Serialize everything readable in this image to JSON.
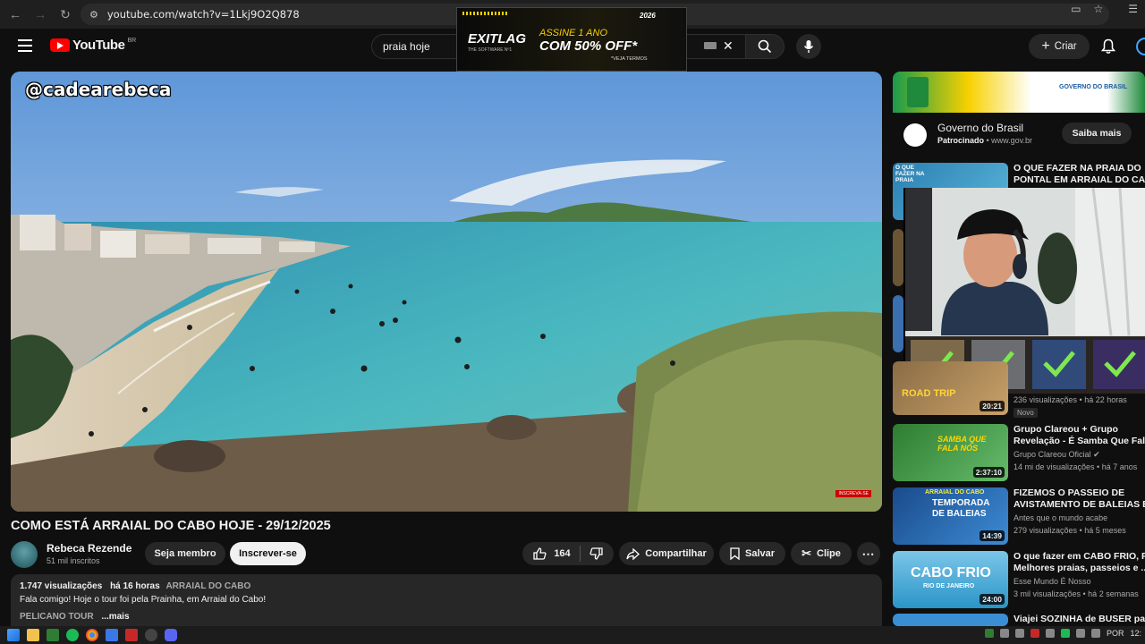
{
  "browser": {
    "url": "youtube.com/watch?v=1Lkj9O2Q878"
  },
  "header": {
    "logo_text": "YouTube",
    "country_code": "BR",
    "search_value": "praia hoje",
    "create_label": "Criar"
  },
  "ad": {
    "brand": "EXITLAG",
    "brand_tag": "THE SOFTWARE Nº1",
    "line1": "ASSINE 1 ANO",
    "line2": "COM 50% OFF*",
    "line3": "*VEJA TERMOS",
    "year": "2026"
  },
  "player": {
    "watermark": "@cadearebeca",
    "rec_badge": "INSCREVA-SE"
  },
  "video": {
    "title": "COMO ESTÁ ARRAIAL DO CABO HOJE - 29/12/2025",
    "channel": "Rebeca Rezende",
    "subscribers": "51 mil inscritos",
    "member_label": "Seja membro",
    "subscribe_label": "Inscrever-se",
    "likes": "164",
    "share_label": "Compartilhar",
    "save_label": "Salvar",
    "clip_label": "Clipe"
  },
  "description": {
    "views": "1.747 visualizações",
    "age": "há 16 horas",
    "tag": "ARRAIAL DO CABO",
    "line1": "Fala comigo! Hoje o tour foi pela Prainha, em Arraial do Cabo!",
    "line2_cut": "PELICANO TOUR",
    "more": "...mais"
  },
  "sponsor": {
    "name": "Governo do Brasil",
    "label": "Patrocinado",
    "domain": "www.gov.br",
    "cta": "Saiba mais",
    "banner_text": "GOVERNO DO BRASIL"
  },
  "recommendations": [
    {
      "title_l1": "O QUE FAZER NA PRAIA DO",
      "title_l2": "PONTAL EM ARRAIAL DO CAB",
      "thumb_text": "O QUE FAZER NA PRAIA",
      "channel": "",
      "stats": "",
      "duration": ""
    },
    {
      "title_l1": "",
      "title_l2": "",
      "thumb_text": "ROAD TRIP",
      "channel": "",
      "stats": "236 visualizações • há 22 horas",
      "badge": "Novo",
      "duration": "20:21"
    },
    {
      "title_l1": "Grupo Clareou + Grupo",
      "title_l2": "Revelação - É Samba Que Fala",
      "thumb_text": "SAMBA QUE FALA NÓS",
      "channel": "Grupo Clareou Oficial",
      "stats": "14 mi de visualizações • há 7 anos",
      "duration": "2:37:10"
    },
    {
      "title_l1": "FIZEMOS O PASSEIO DE",
      "title_l2": "AVISTAMENTO DE BALEIAS E...",
      "thumb_text_a": "ARRAIAL DO CABO",
      "thumb_text_b": "TEMPORADA DE BALEIAS",
      "channel": "Antes que o mundo acabe",
      "stats": "279 visualizações • há 5 meses",
      "duration": "14:39"
    },
    {
      "title_l1": "O que fazer em CABO FRIO, RJ",
      "title_l2": "Melhores praias, passeios e ...",
      "thumb_text_a": "CABO FRIO",
      "thumb_text_b": "RIO DE JANEIRO",
      "channel": "Esse Mundo É Nosso",
      "stats": "3 mil visualizações • há 2 semanas",
      "duration": "24:00"
    },
    {
      "title_l1": "Viajei SOZINHA de BUSER para",
      "title_l2": "",
      "channel": "",
      "stats": "",
      "duration": ""
    }
  ],
  "taskbar": {
    "lang": "POR",
    "time": "12:"
  },
  "colors": {
    "bg": "#0f0f0f",
    "surface": "#272727",
    "brand_red": "#ff0000",
    "accent_blue": "#3ea6ff"
  }
}
